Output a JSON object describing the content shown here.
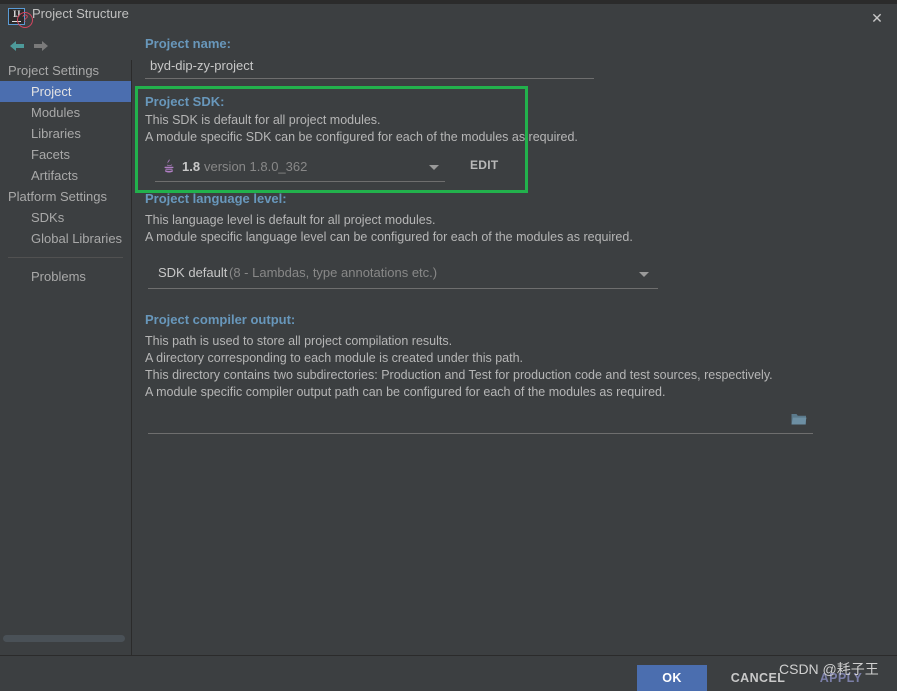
{
  "window": {
    "title": "Project Structure",
    "logo_text": "IJ",
    "close_label": "✕"
  },
  "nav": {
    "back_label": "back-arrow",
    "forward_label": "forward-arrow"
  },
  "sidebar": {
    "groups": [
      {
        "label": "Project Settings",
        "items": [
          {
            "label": "Project",
            "selected": true
          },
          {
            "label": "Modules",
            "selected": false
          },
          {
            "label": "Libraries",
            "selected": false
          },
          {
            "label": "Facets",
            "selected": false
          },
          {
            "label": "Artifacts",
            "selected": false
          }
        ]
      },
      {
        "label": "Platform Settings",
        "items": [
          {
            "label": "SDKs",
            "selected": false
          },
          {
            "label": "Global Libraries",
            "selected": false
          }
        ]
      }
    ],
    "problems_label": "Problems"
  },
  "main": {
    "project_name": {
      "heading": "Project name:",
      "value": "byd-dip-zy-project"
    },
    "project_sdk": {
      "heading": "Project SDK:",
      "desc_line1": "This SDK is default for all project modules.",
      "desc_line2": "A module specific SDK can be configured for each of the modules as required.",
      "selected_name": "1.8",
      "selected_version": "version 1.8.0_362",
      "edit_label": "EDIT",
      "highlight_color": "#22b14c"
    },
    "language_level": {
      "heading": "Project language level:",
      "desc_line1": "This language level is default for all project modules.",
      "desc_line2": "A module specific language level can be configured for each of the modules as required.",
      "selected_name": "SDK default",
      "selected_detail": "(8 - Lambdas, type annotations etc.)"
    },
    "compiler_output": {
      "heading": "Project compiler output:",
      "desc_line1": "This path is used to store all project compilation results.",
      "desc_line2": "A directory corresponding to each module is created under this path.",
      "desc_line3": "This directory contains two subdirectories: Production and Test for production code and test sources, respectively.",
      "desc_line4": "A module specific compiler output path can be configured for each of the modules as required.",
      "value": ""
    }
  },
  "footer": {
    "help_label": "?",
    "ok_label": "OK",
    "cancel_label": "CANCEL",
    "apply_label": "APPLY",
    "watermark": "CSDN @耗子王"
  }
}
